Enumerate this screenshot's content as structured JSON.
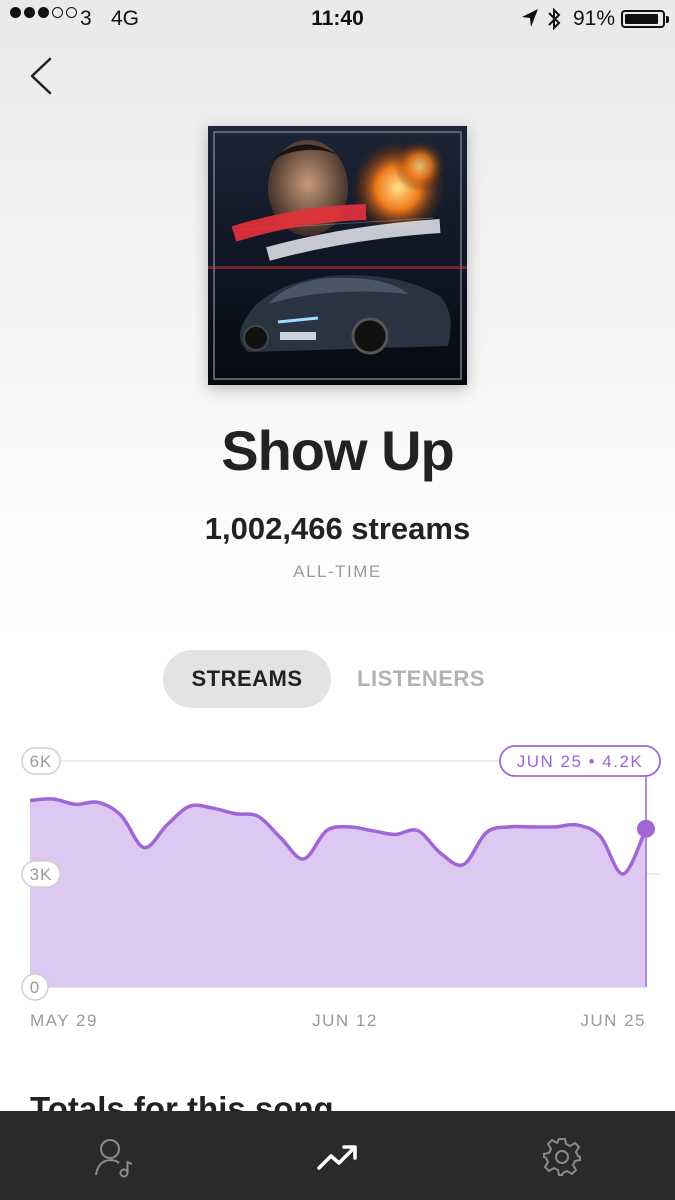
{
  "status_bar": {
    "carrier": "3",
    "network": "4G",
    "time": "11:40",
    "battery": "91%",
    "signal_bars_filled": 3,
    "signal_bars_total": 5,
    "battery_level": 0.91
  },
  "song": {
    "title": "Show Up",
    "streams": "1,002,466 streams",
    "period": "ALL-TIME"
  },
  "tabs": [
    {
      "label": "STREAMS",
      "active": true
    },
    {
      "label": "LISTENERS",
      "active": false
    }
  ],
  "chart_data": {
    "type": "area",
    "x": [
      "May 29",
      "May 30",
      "May 31",
      "Jun 1",
      "Jun 2",
      "Jun 3",
      "Jun 4",
      "Jun 5",
      "Jun 6",
      "Jun 7",
      "Jun 8",
      "Jun 9",
      "Jun 10",
      "Jun 11",
      "Jun 12",
      "Jun 13",
      "Jun 14",
      "Jun 15",
      "Jun 16",
      "Jun 17",
      "Jun 18",
      "Jun 19",
      "Jun 20",
      "Jun 21",
      "Jun 22",
      "Jun 23",
      "Jun 24",
      "Jun 25"
    ],
    "series": [
      {
        "values": [
          4950,
          4990,
          4850,
          4900,
          4550,
          3700,
          4300,
          4800,
          4750,
          4600,
          4530,
          3950,
          3400,
          4150,
          4250,
          4150,
          4050,
          4150,
          3550,
          3250,
          4100,
          4250,
          4250,
          4250,
          4300,
          4000,
          3000,
          4200
        ]
      }
    ],
    "ylim": [
      0,
      6000
    ],
    "y_ticks": [
      "0",
      "3K",
      "6K"
    ],
    "x_ticks": [
      "MAY 29",
      "JUN 12",
      "JUN 25"
    ],
    "tooltip": "JUN 25 • 4.2K",
    "color": "#a066d8",
    "fill_color": "#dcc8f2"
  },
  "totals_heading": "Totals for this song",
  "bottom_nav": [
    {
      "icon": "profile-music-icon",
      "active": false
    },
    {
      "icon": "trending-icon",
      "active": true
    },
    {
      "icon": "gear-icon",
      "active": false
    }
  ]
}
